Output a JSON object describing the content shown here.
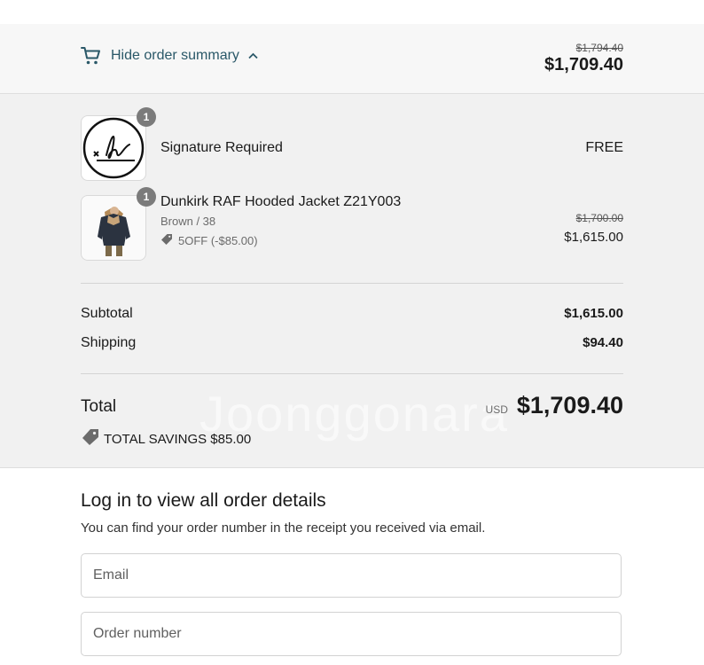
{
  "header": {
    "toggle_label": "Hide order summary",
    "original_total": "$1,794.40",
    "total": "$1,709.40"
  },
  "items": [
    {
      "title": "Signature Required",
      "quantity": "1",
      "price": "FREE",
      "image_icon": "signature-icon"
    },
    {
      "title": "Dunkirk RAF Hooded Jacket Z21Y003",
      "quantity": "1",
      "variant": "Brown / 38",
      "discount": "5OFF (-$85.00)",
      "original_price": "$1,700.00",
      "price": "$1,615.00",
      "image_icon": "jacket-photo"
    }
  ],
  "totals": {
    "subtotal_label": "Subtotal",
    "subtotal_value": "$1,615.00",
    "shipping_label": "Shipping",
    "shipping_value": "$94.40",
    "total_label": "Total",
    "currency": "USD",
    "total_value": "$1,709.40",
    "savings": "TOTAL SAVINGS $85.00"
  },
  "login": {
    "title": "Log in to view all order details",
    "subtitle": "You can find your order number in the receipt you received via email.",
    "email_placeholder": "Email",
    "order_placeholder": "Order number"
  },
  "watermark": "Joonggonara",
  "colors": {
    "accent": "#2a5868",
    "summary_bg": "#f1f1f1",
    "bar_bg": "#f7f7f7"
  }
}
